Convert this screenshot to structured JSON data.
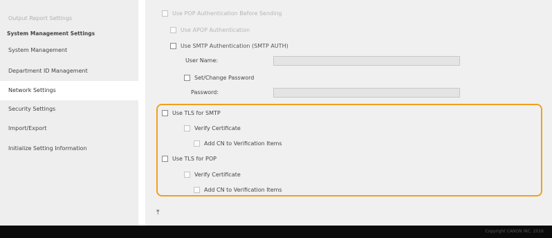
{
  "sidebar": {
    "items": [
      {
        "label": "Output Report Settings"
      },
      {
        "label": "System Management"
      },
      {
        "label": "Department ID Management"
      },
      {
        "label": "Network Settings"
      },
      {
        "label": "Security Settings"
      },
      {
        "label": "Import/Export"
      },
      {
        "label": "Initialize Setting Information"
      }
    ],
    "heading": "System Management Settings",
    "active": "Network Settings"
  },
  "main": {
    "pop_auth": "Use POP Authentication Before Sending",
    "apop_auth": "Use APOP Authentication",
    "smtp_auth": "Use SMTP Authentication (SMTP AUTH)",
    "user_name_label": "User Name:",
    "user_name_value": "",
    "set_change_password": "Set/Change Password",
    "password_label": "Password:",
    "password_value": "",
    "tls_smtp": "Use TLS for SMTP",
    "tls_smtp_verify": "Verify Certificate",
    "tls_smtp_addcn": "Add CN to Verification Items",
    "tls_pop": "Use TLS for POP",
    "tls_pop_verify": "Verify Certificate",
    "tls_pop_addcn": "Add CN to Verification Items",
    "top_link_icon": "to-top-icon"
  },
  "footer": {
    "copyright": "Copyright CANON INC. 2016"
  },
  "colors": {
    "highlight": "#f0a01c",
    "sidebar_bg": "#eeeeee",
    "main_bg": "#f0f0f0"
  }
}
